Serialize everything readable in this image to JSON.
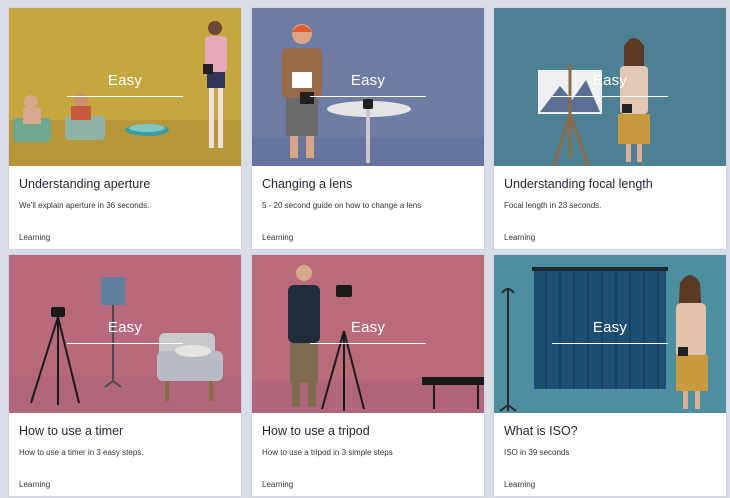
{
  "cards": [
    {
      "difficulty": "Easy",
      "title": "Understanding aperture",
      "description": "We'll explain aperture in 36 seconds.",
      "category": "Learning",
      "bg": "#c5a640"
    },
    {
      "difficulty": "Easy",
      "title": "Changing a lens",
      "description": "5 - 20 second guide on how to change a lens",
      "category": "Learning",
      "bg": "#6e7ca4"
    },
    {
      "difficulty": "Easy",
      "title": "Understanding focal length",
      "description": "Focal length in 23 seconds.",
      "category": "Learning",
      "bg": "#4d8093"
    },
    {
      "difficulty": "Easy",
      "title": "How to use a timer",
      "description": "How to use a timer in 3 easy steps.",
      "category": "Learning",
      "bg": "#b86a7c"
    },
    {
      "difficulty": "Easy",
      "title": "How to use a tripod",
      "description": "How to use a tripod in 3 simple steps",
      "category": "Learning",
      "bg": "#b96b7b"
    },
    {
      "difficulty": "Easy",
      "title": "What is ISO?",
      "description": "ISO in 39 seconds",
      "category": "Learning",
      "bg": "#4d8fa0"
    }
  ]
}
